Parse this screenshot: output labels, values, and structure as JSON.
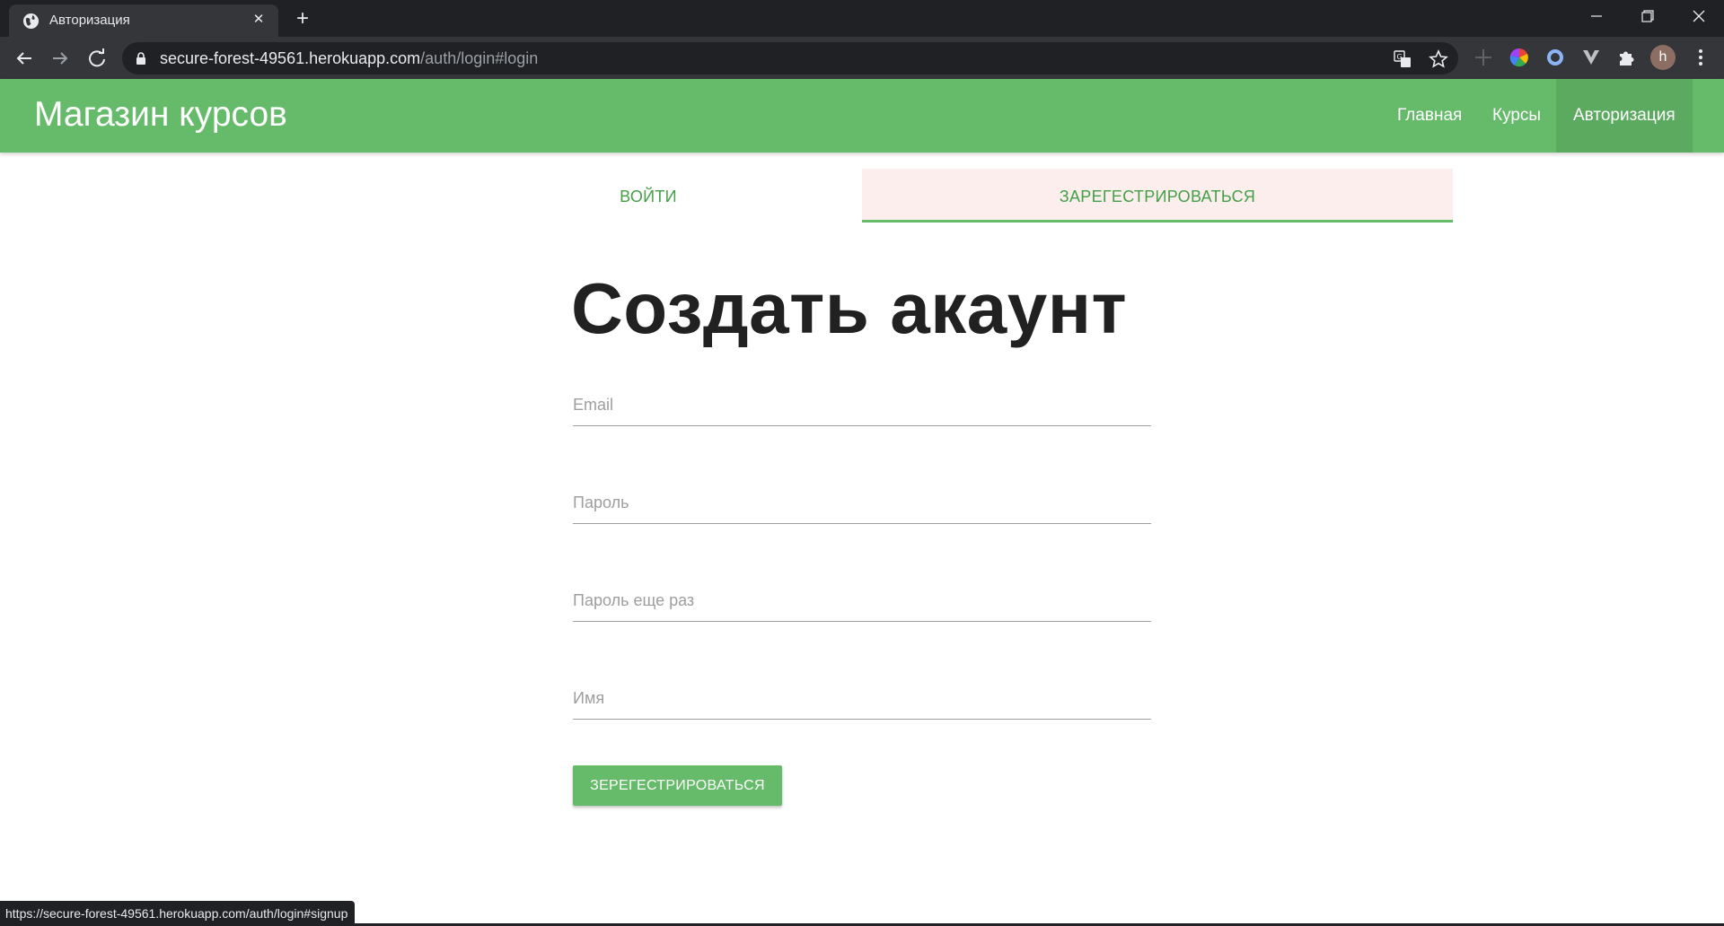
{
  "browser": {
    "tab_title": "Авторизация",
    "new_tab_symbol": "+",
    "close_symbol": "✕",
    "url_host": "secure-forest-49561.herokuapp.com",
    "url_path": "/auth/login#login",
    "profile_initial": "h",
    "status_url": "https://secure-forest-49561.herokuapp.com/auth/login#signup",
    "icons": [
      "globe-icon",
      "back-arrow-icon",
      "forward-arrow-icon",
      "reload-icon",
      "lock-icon",
      "translate-icon",
      "star-icon",
      "extension-crosshair-icon",
      "extension-color-wheel-icon",
      "extension-ring-icon",
      "extension-v-icon",
      "puzzle-icon",
      "avatar",
      "kebab-menu-icon",
      "minimize-icon",
      "restore-icon",
      "window-close-icon"
    ]
  },
  "header": {
    "brand": "Магазин курсов",
    "nav": [
      {
        "label": "Главная",
        "active": false
      },
      {
        "label": "Курсы",
        "active": false
      },
      {
        "label": "Авторизация",
        "active": true
      }
    ]
  },
  "tabs": {
    "login": "Войти",
    "signup": "Зарегестрироваться",
    "active": "signup"
  },
  "form": {
    "title": "Создать акаунт",
    "email_placeholder": "Email",
    "password_placeholder": "Пароль",
    "password_repeat_placeholder": "Пароль еще раз",
    "name_placeholder": "Имя",
    "submit_label": "Зерегестрироваться"
  },
  "colors": {
    "accent": "#66bb6a",
    "accent_text": "#43a047",
    "active_tab_bg": "#fbeeec",
    "chrome_dark": "#202124",
    "chrome_toolbar": "#35363a"
  }
}
